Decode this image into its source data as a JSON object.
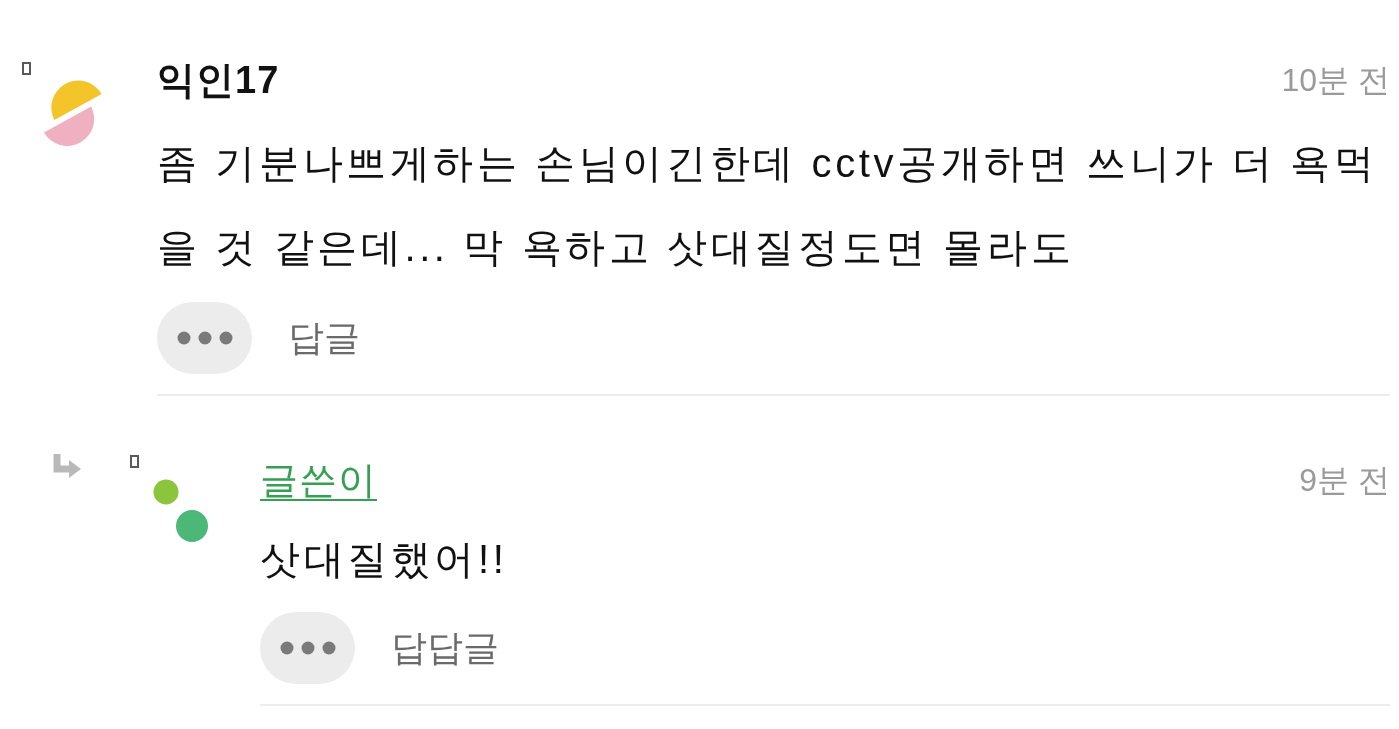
{
  "comments": [
    {
      "author": "익인17",
      "is_writer": false,
      "time": "10분 전",
      "body": "좀 기분나쁘게하는 손님이긴한데 cctv공개하면 쓰니가 더 욕먹을 것 같은데... 막 욕하고 삿대질정도면 몰라도",
      "reply_label": "답글",
      "replies": [
        {
          "author": "글쓴이",
          "is_writer": true,
          "time": "9분 전",
          "body": "삿대질했어!!",
          "reply_label": "답답글"
        }
      ]
    }
  ]
}
